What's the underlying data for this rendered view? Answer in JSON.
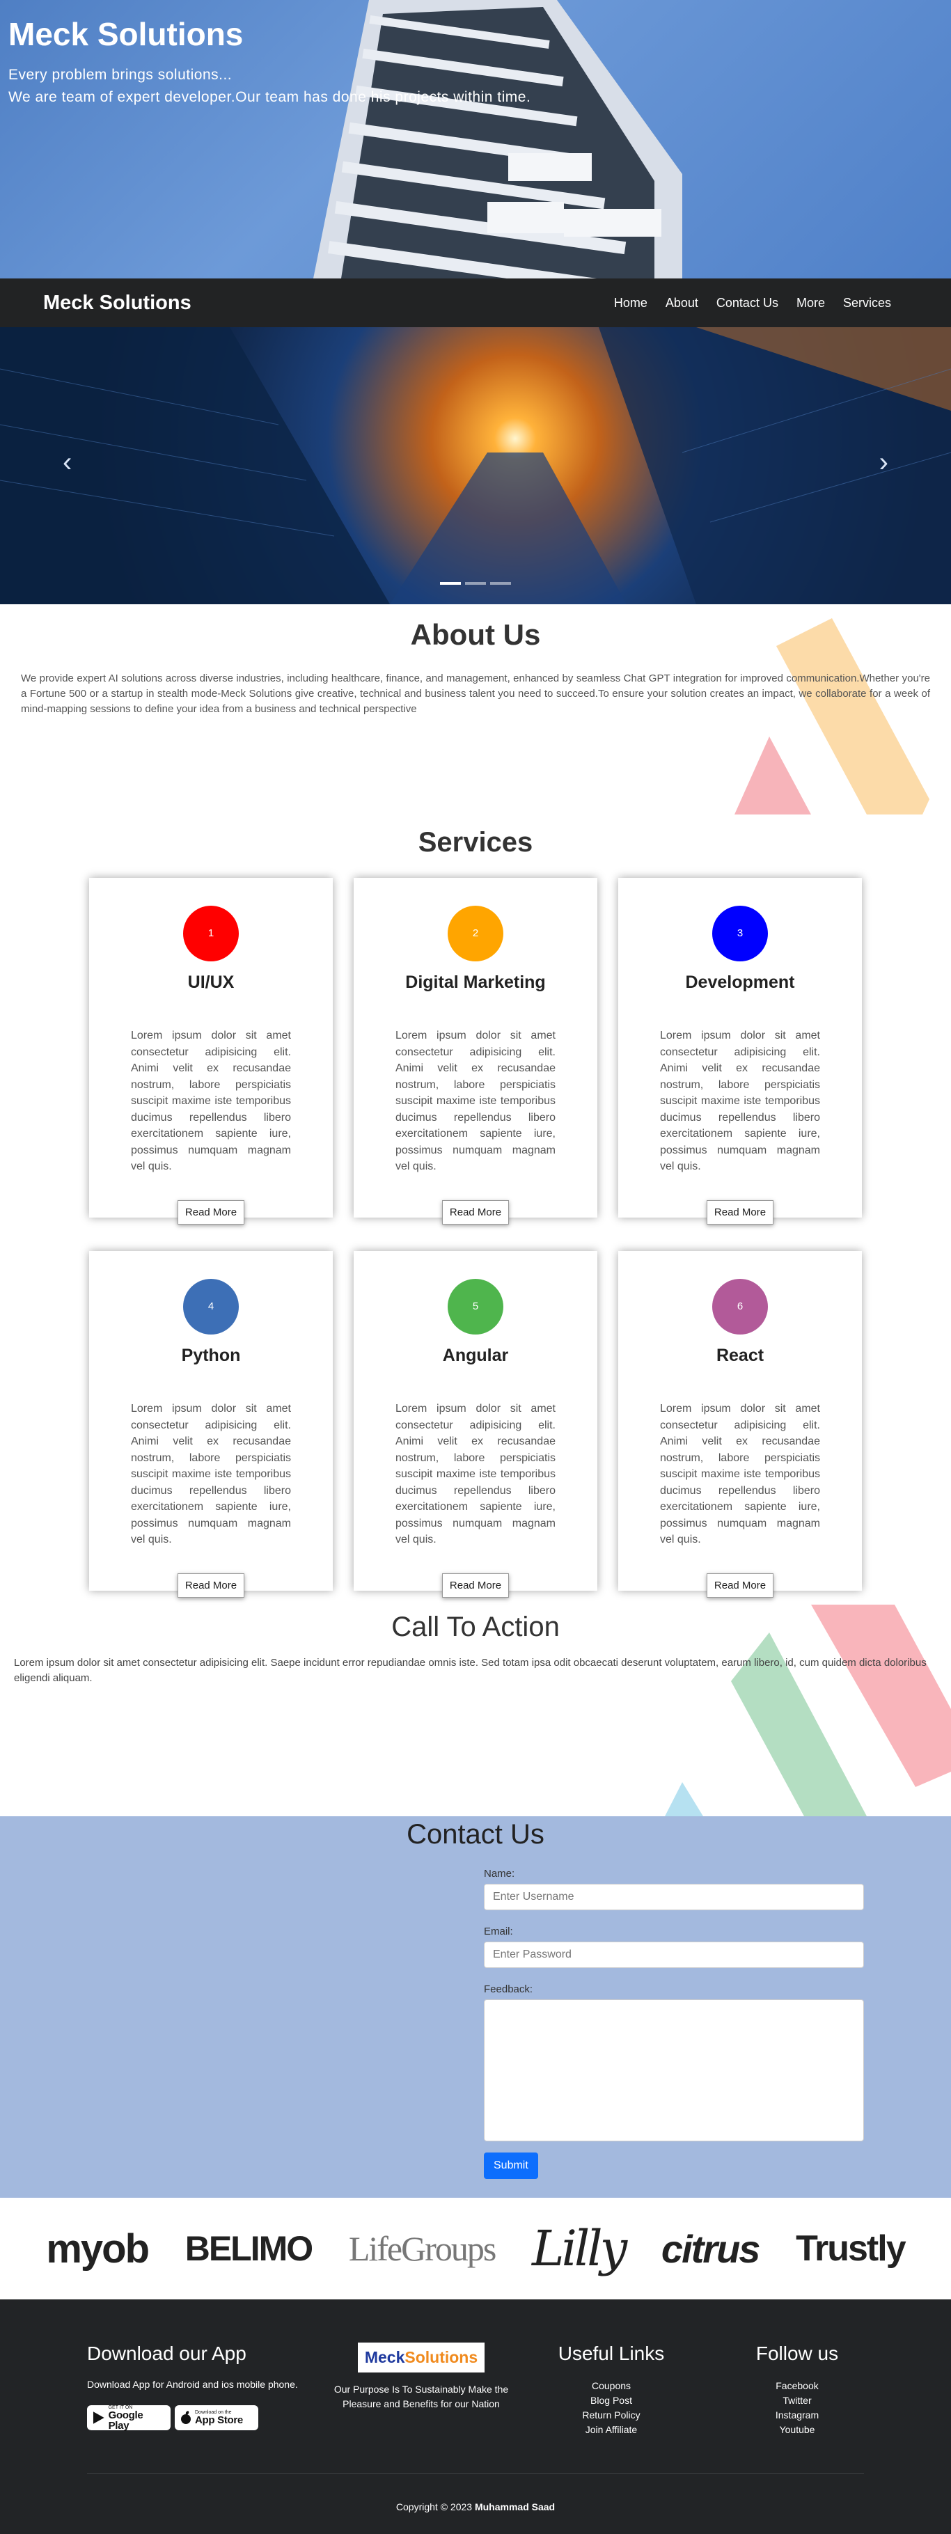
{
  "hero": {
    "title": "Meck Solutions",
    "line1": "Every problem brings solutions...",
    "line2": "We are team of expert developer.Our team has done his projects within time."
  },
  "nav": {
    "brand": "Meck Solutions",
    "links": [
      "Home",
      "About",
      "Contact Us",
      "More",
      "Services"
    ]
  },
  "carousel": {
    "prev_icon": "chevron-left-icon",
    "next_icon": "chevron-right-icon",
    "slide_count": 3,
    "active_slide": 1
  },
  "about": {
    "title": "About Us",
    "text": "We provide expert AI solutions across diverse industries, including healthcare, finance, and management, enhanced by seamless Chat GPT integration for improved communication.Whether you're a Fortune 500 or a startup in stealth mode-Meck Solutions give creative, technical and business talent you need to succeed.To ensure your solution creates an impact, we collaborate for a week of mind-mapping sessions to define your idea from a business and technical perspective"
  },
  "services": {
    "title": "Services",
    "card_text": "Lorem ipsum dolor sit amet consectetur adipisicing elit. Animi velit ex recusandae nostrum, labore perspiciatis suscipit maxime iste temporibus ducimus repellendus libero exercitationem sapiente iure, possimus numquam magnam vel quis.",
    "button_label": "Read More",
    "cards": [
      {
        "num": "1",
        "title": "UI/UX",
        "color": "#ff0000"
      },
      {
        "num": "2",
        "title": "Digital Marketing",
        "color": "#ffa500"
      },
      {
        "num": "3",
        "title": "Development",
        "color": "#0000ff"
      },
      {
        "num": "4",
        "title": "Python",
        "color": "#3d6fb6"
      },
      {
        "num": "5",
        "title": "Angular",
        "color": "#4fb54d"
      },
      {
        "num": "6",
        "title": "React",
        "color": "#b25a99"
      }
    ]
  },
  "cta": {
    "title": "Call To Action",
    "text": "Lorem ipsum dolor sit amet consectetur adipisicing elit. Saepe incidunt error repudiandae omnis iste. Sed totam ipsa odit obcaecati deserunt voluptatem, earum libero, id, cum quidem dicta doloribus eligendi aliquam."
  },
  "contact": {
    "title": "Contact Us",
    "name_label": "Name:",
    "name_placeholder": "Enter Username",
    "email_label": "Email:",
    "email_placeholder": "Enter Password",
    "feedback_label": "Feedback:",
    "submit_label": "Submit"
  },
  "partners": [
    "myob",
    "BELIMO",
    "LifeGroups",
    "Lilly",
    "citrus",
    "Trustly"
  ],
  "footer": {
    "app_title": "Download our App",
    "app_text": "Download App for Android and ios mobile phone.",
    "google_sub": "GET IT ON",
    "google_main": "Google Play",
    "apple_sub": "Download on the",
    "apple_main": "App Store",
    "logo_part1": "Meck",
    "logo_part2": "Solutions",
    "purpose": "Our Purpose Is To Sustainably Make the Pleasure and Benefits for our Nation",
    "links_title": "Useful Links",
    "links": [
      "Coupons",
      "Blog Post",
      "Return Policy",
      "Join Affiliate"
    ],
    "follow_title": "Follow us",
    "follow": [
      "Facebook",
      "Twitter",
      "Instagram",
      "Youtube"
    ],
    "copyright_prefix": "Copyright © 2023",
    "copyright_name": "Muhammad Saad"
  },
  "colors": {
    "navbar": "#222324",
    "contact_bg": "#a3b9de",
    "submit": "#0d6efd",
    "footer": "#222426"
  }
}
